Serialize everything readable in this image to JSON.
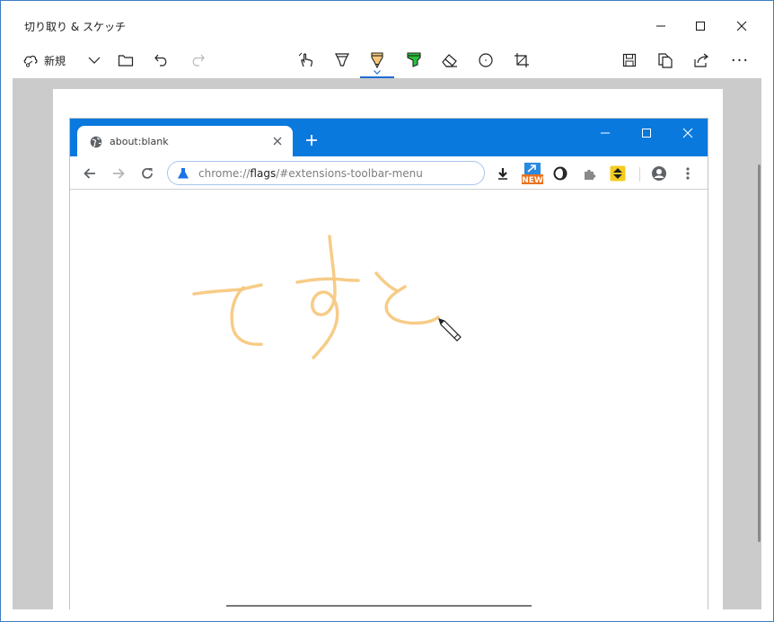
{
  "app": {
    "title": "切り取り & スケッチ"
  },
  "toolbar": {
    "new_label": "新規",
    "more_label": "···"
  },
  "chrome": {
    "tab_title": "about:blank",
    "omnibox_prefix": "chrome://",
    "omnibox_host": "flags",
    "omnibox_rest": "/#extensions-toolbar-menu",
    "ext_new_badge": "NEW"
  },
  "colors": {
    "accent": "#1f6bd1",
    "chrome_titlebar": "#0a79de",
    "pencil_ink": "#f6c77a",
    "highlighter": "#29c23b",
    "canvas_bg": "#cbcbcb"
  },
  "icons": {
    "new": "snip-new-icon",
    "open": "folder-icon",
    "undo": "undo-icon",
    "redo": "redo-icon",
    "touch": "touch-writing-icon",
    "pen": "ballpoint-pen-icon",
    "pencil": "pencil-icon",
    "highlighter": "highlighter-icon",
    "eraser": "eraser-icon",
    "ruler": "protractor-icon",
    "crop": "crop-icon",
    "save": "save-icon",
    "copy": "copy-icon",
    "share": "share-icon"
  },
  "ink_text": "ですと"
}
